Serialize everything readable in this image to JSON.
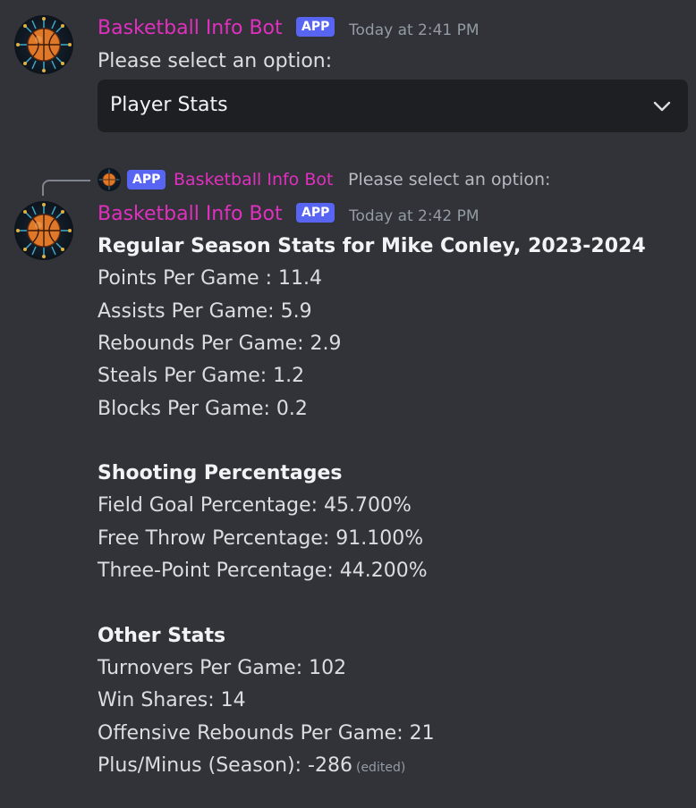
{
  "colors": {
    "background": "#313338",
    "bot_name": "#e12fbf",
    "app_badge": "#5865f2",
    "select_bg": "#1e1f22",
    "text": "#dbdee1",
    "muted": "#949ba4"
  },
  "message1": {
    "author": "Basketball Info Bot",
    "badge": "APP",
    "timestamp": "Today at 2:41 PM",
    "text": "Please select an option:",
    "avatar_icon": "basketball-circuit-icon",
    "select": {
      "value": "Player Stats",
      "icon": "chevron-down-icon"
    }
  },
  "reply_preview": {
    "badge": "APP",
    "author": "Basketball Info Bot",
    "text": "Please select an option:"
  },
  "message2": {
    "author": "Basketball Info Bot",
    "badge": "APP",
    "timestamp": "Today at 2:42 PM",
    "heading": "Regular Season Stats for Mike Conley, 2023-2024",
    "stats": [
      "Points Per Game : 11.4",
      "Assists Per Game: 5.9",
      "Rebounds Per Game: 2.9",
      "Steals Per Game: 1.2",
      "Blocks Per Game: 0.2"
    ],
    "shooting_heading": "Shooting Percentages",
    "shooting": [
      "Field Goal Percentage: 45.700%",
      "Free Throw Percentage: 91.100%",
      "Three-Point Percentage: 44.200%"
    ],
    "other_heading": "Other Stats",
    "other": [
      "Turnovers Per Game: 102",
      "Win Shares: 14",
      "Offensive Rebounds Per Game: 21",
      "Plus/Minus (Season): -286"
    ],
    "edited": "(edited)"
  }
}
